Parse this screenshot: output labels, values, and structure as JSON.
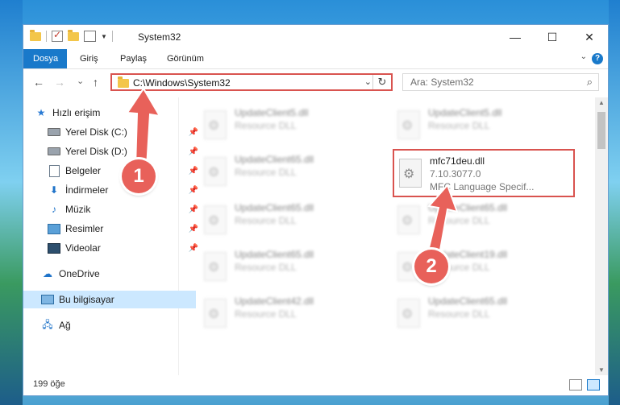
{
  "window": {
    "title": "System32"
  },
  "window_controls": {
    "minimize": "—",
    "maximize": "☐",
    "close": "✕"
  },
  "ribbon": {
    "tabs": [
      "Dosya",
      "Giriş",
      "Paylaş",
      "Görünüm"
    ],
    "help": "?"
  },
  "nav": {
    "back": "←",
    "forward": "→",
    "recent": "⌄",
    "up": "↑"
  },
  "address": {
    "path": "C:\\Windows\\System32",
    "dropdown": "⌄",
    "refresh": "↻"
  },
  "search": {
    "placeholder": "Ara: System32",
    "icon": "⌕"
  },
  "sidebar": {
    "quick_access": "Hızlı erişim",
    "items": [
      {
        "label": "Yerel Disk (C:)",
        "icon": "disk-icon"
      },
      {
        "label": "Yerel Disk (D:)",
        "icon": "disk-icon"
      },
      {
        "label": "Belgeler",
        "icon": "documents-icon"
      },
      {
        "label": "İndirmeler",
        "icon": "downloads-icon"
      },
      {
        "label": "Müzik",
        "icon": "music-icon"
      },
      {
        "label": "Resimler",
        "icon": "pictures-icon"
      },
      {
        "label": "Videolar",
        "icon": "videos-icon"
      }
    ],
    "onedrive": "OneDrive",
    "this_pc": "Bu bilgisayar",
    "network": "Ağ",
    "pin": "📌"
  },
  "files": [
    {
      "name": "UpdateClient5.dll",
      "desc": "Resource DLL"
    },
    {
      "name": "UpdateClient5.dll",
      "desc": "Resource DLL"
    },
    {
      "name": "UpdateClient65.dll",
      "desc": "Resource DLL"
    },
    {
      "name": "UpdateClient65.dll",
      "desc": "Resource DLL"
    },
    {
      "name": "UpdateClient65.dll",
      "desc": "Resource DLL"
    },
    {
      "name": "UpdateClient65.dll",
      "desc": "Resource DLL"
    },
    {
      "name": "UpdateClient19.dll",
      "desc": "Resource DLL"
    },
    {
      "name": "UpdateClient42.dll",
      "desc": "Resource DLL"
    },
    {
      "name": "UpdateClient65.dll",
      "desc": "Resource DLL"
    }
  ],
  "highlighted_file": {
    "name": "mfc71deu.dll",
    "version": "7.10.3077.0",
    "desc": "MFC Language Specif..."
  },
  "status": {
    "count": "199 öğe"
  },
  "annotations": [
    "1",
    "2"
  ],
  "colors": {
    "accent": "#1979ca",
    "highlight": "#d9534f",
    "annotation": "#e8615a"
  }
}
